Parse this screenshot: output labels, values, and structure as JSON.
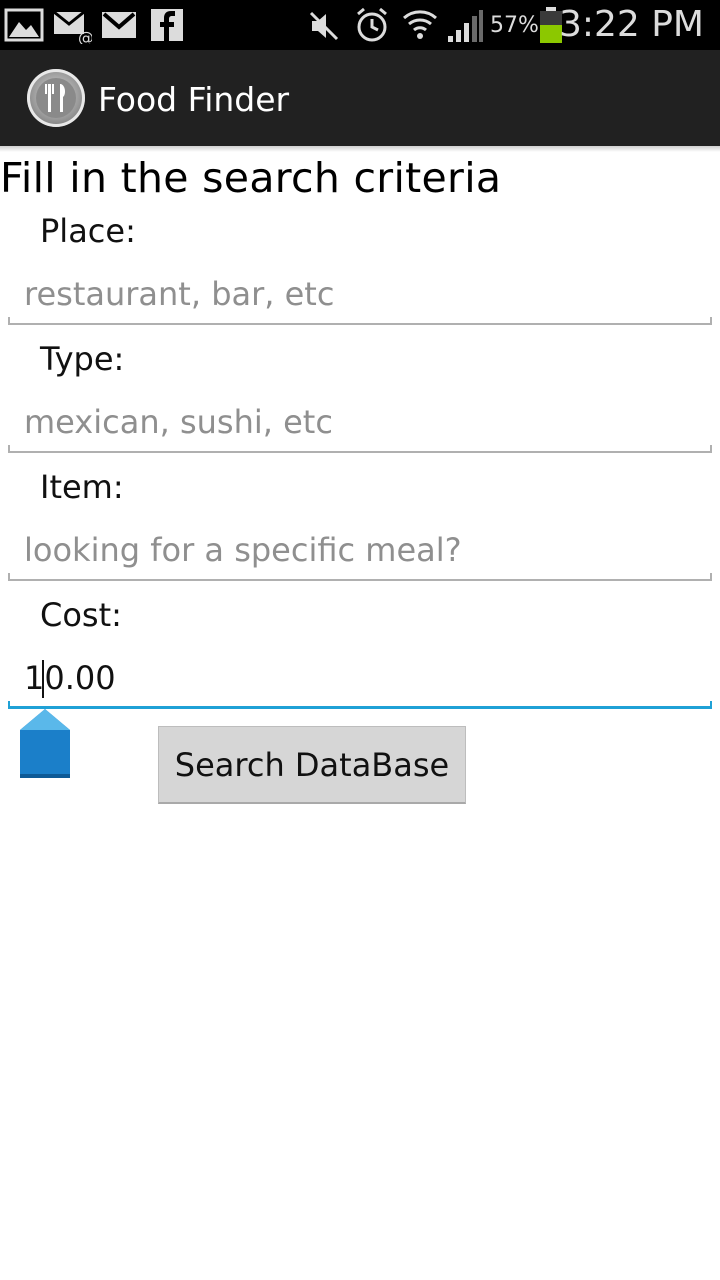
{
  "status_bar": {
    "battery_percent": "57%",
    "time": "3:22 PM",
    "icons": [
      "gallery-icon",
      "email-icon",
      "gmail-icon",
      "facebook-icon",
      "mute-icon",
      "alarm-icon",
      "wifi-icon",
      "signal-icon",
      "battery-icon"
    ],
    "battery_color": "#8cc800"
  },
  "action_bar": {
    "title": "Food Finder",
    "logo": "fork-knife-plate-icon"
  },
  "form": {
    "heading": "Fill in the search criteria",
    "place_label": "Place:",
    "place_placeholder": "restaurant, bar, etc",
    "type_label": "Type:",
    "type_placeholder": "mexican, sushi, etc",
    "item_label": "Item:",
    "item_placeholder": "looking for a specific meal?",
    "cost_label": "Cost:",
    "cost_value": "10.00",
    "search_button": "Search DataBase"
  },
  "colors": {
    "accent": "#1fa1d6",
    "action_bar": "#212121"
  }
}
